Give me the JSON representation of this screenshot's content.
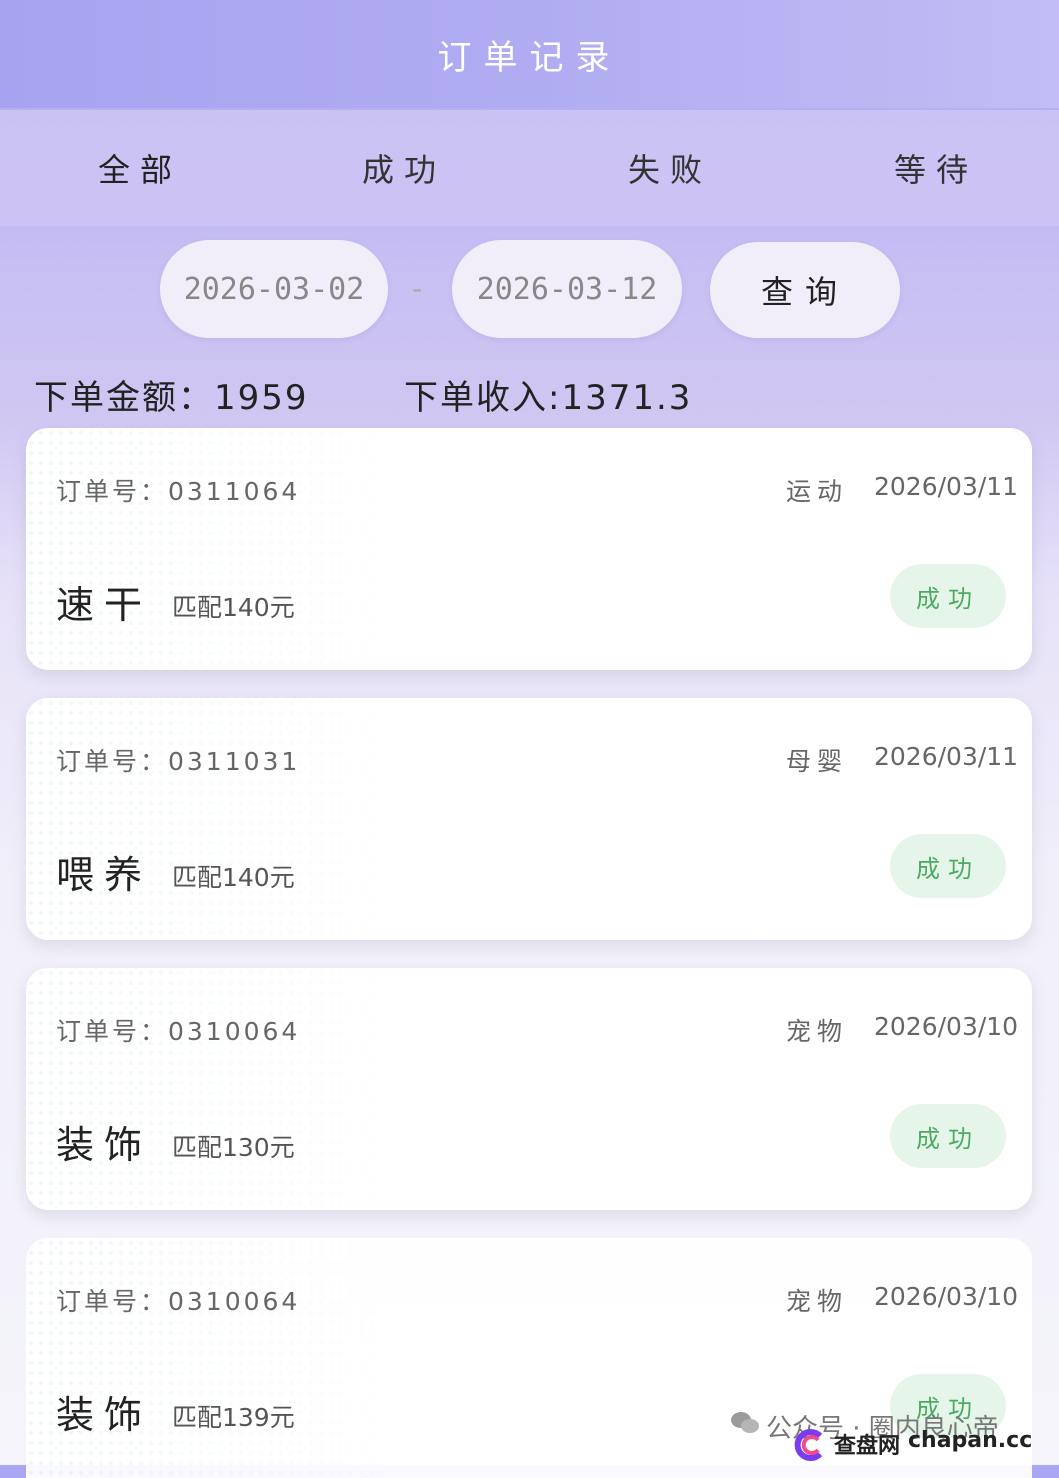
{
  "header": {
    "title": "订单记录"
  },
  "tabs": [
    {
      "label": "全部",
      "active": true
    },
    {
      "label": "成功",
      "active": false
    },
    {
      "label": "失败",
      "active": false
    },
    {
      "label": "等待",
      "active": false
    }
  ],
  "filter": {
    "start_date": "2026-03-02",
    "separator": "-",
    "end_date": "2026-03-12",
    "query_label": "查询"
  },
  "summary": {
    "amount_text": "下单金额：1959",
    "income_text": "下单收入:1371.3"
  },
  "orders": [
    {
      "order_no": "订单号：0311064",
      "category": "运动",
      "date": "2026/03/11",
      "name": "速干",
      "match": "匹配140元",
      "status": "成功"
    },
    {
      "order_no": "订单号：0311031",
      "category": "母婴",
      "date": "2026/03/11",
      "name": "喂养",
      "match": "匹配140元",
      "status": "成功"
    },
    {
      "order_no": "订单号：0310064",
      "category": "宠物",
      "date": "2026/03/10",
      "name": "装饰",
      "match": "匹配130元",
      "status": "成功"
    },
    {
      "order_no": "订单号：0310064",
      "category": "宠物",
      "date": "2026/03/10",
      "name": "装饰",
      "match": "匹配139元",
      "status": "成功"
    }
  ],
  "watermark": {
    "line1": "公众号 · 圈内良心帝",
    "site_cn": "查盘网",
    "site_en": "chapan.cc"
  },
  "colors": {
    "header_bg": "#a8a3f0",
    "status_bg": "#e6f5ea",
    "status_text": "#4caa62"
  }
}
